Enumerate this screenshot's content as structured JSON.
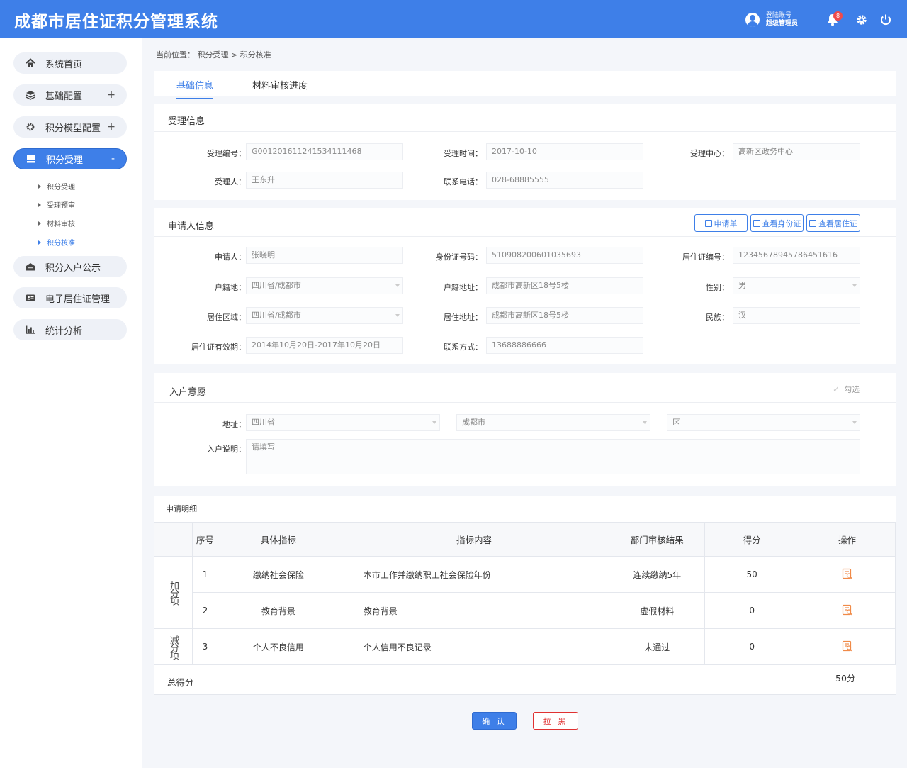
{
  "header": {
    "title": "成都市居住证积分管理系统",
    "login_label": "登陆账号",
    "user_role": "超级管理员",
    "notification_count": "8",
    "accent_color": "#3e7fe8"
  },
  "sidebar": {
    "items": [
      {
        "label": "系统首页",
        "icon": "home-icon",
        "toggle": ""
      },
      {
        "label": "基础配置",
        "icon": "layers-icon",
        "toggle": "+"
      },
      {
        "label": "积分模型配置",
        "icon": "gear-icon",
        "toggle": "+"
      },
      {
        "label": "积分受理",
        "icon": "inbox-icon",
        "toggle": "-"
      },
      {
        "label": "积分入户公示",
        "icon": "house-icon",
        "toggle": ""
      },
      {
        "label": "电子居住证管理",
        "icon": "id-card-icon",
        "toggle": ""
      },
      {
        "label": "统计分析",
        "icon": "bar-chart-icon",
        "toggle": ""
      }
    ],
    "sub_items": [
      "积分受理",
      "受理预审",
      "材料审核",
      "积分核准"
    ]
  },
  "breadcrumb": {
    "text": "当前位置： 积分受理 > 积分核准"
  },
  "tabs": [
    "基础信息",
    "材料审核进度"
  ],
  "acceptance": {
    "title": "受理信息",
    "fields": {
      "no_label": "受理编号：",
      "no_value": "G001201611241534111468",
      "time_label": "受理时间：",
      "time_value": "2017-10-10",
      "center_label": "受理中心：",
      "center_value": "高新区政务中心",
      "person_label": "受理人：",
      "person_value": "王东升",
      "phone_label": "联系电话：",
      "phone_value": "028-68885555"
    }
  },
  "applicant": {
    "title": "申请人信息",
    "buttons": [
      "申请单",
      "查看身份证",
      "查看居住证"
    ],
    "fields": {
      "name_label": "申请人：",
      "name_value": "张晓明",
      "id_label": "身份证号码：",
      "id_value": "510908200601035693",
      "permit_label": "居住证编号：",
      "permit_value": "12345678945786451616",
      "huji_label": "户籍地：",
      "huji_value": "四川省/成都市",
      "huji_addr_label": "户籍地址：",
      "huji_addr_value": "成都市高新区18号5楼",
      "gender_label": "性别：",
      "gender_value": "男",
      "area_label": "居住区域：",
      "area_value": "四川省/成都市",
      "addr_label": "居住地址：",
      "addr_value": "成都市高新区18号5楼",
      "nation_label": "民族：",
      "nation_value": "汉",
      "valid_label": "居住证有效期：",
      "valid_value": "2014年10月20日-2017年10月20日",
      "contact_label": "联系方式：",
      "contact_value": "13688886666"
    }
  },
  "settle": {
    "title": "入户意愿",
    "check_label": "勾选",
    "address_label": "地址：",
    "province": "四川省",
    "city": "成都市",
    "district": "区",
    "desc_label": "入户说明：",
    "desc_placeholder": "请填写"
  },
  "detail": {
    "title": "申请明细",
    "headers": [
      "序号",
      "具体指标",
      "指标内容",
      "部门审核结果",
      "得分",
      "操作"
    ],
    "group_add": "加分项",
    "group_sub": "减分项",
    "rows": [
      {
        "no": "1",
        "indicator": "缴纳社会保险",
        "content": "本市工作并缴纳职工社会保险年份",
        "result": "连续缴纳5年",
        "score": "50"
      },
      {
        "no": "2",
        "indicator": "教育背景",
        "content": "教育背景",
        "result": "虚假材料",
        "score": "0"
      },
      {
        "no": "3",
        "indicator": "个人不良信用",
        "content": "个人信用不良记录",
        "result": "未通过",
        "score": "0"
      }
    ],
    "total_label": "总得分",
    "total_value": "50分"
  },
  "actions": {
    "confirm": "确 认",
    "blacklist": "拉 黑"
  }
}
